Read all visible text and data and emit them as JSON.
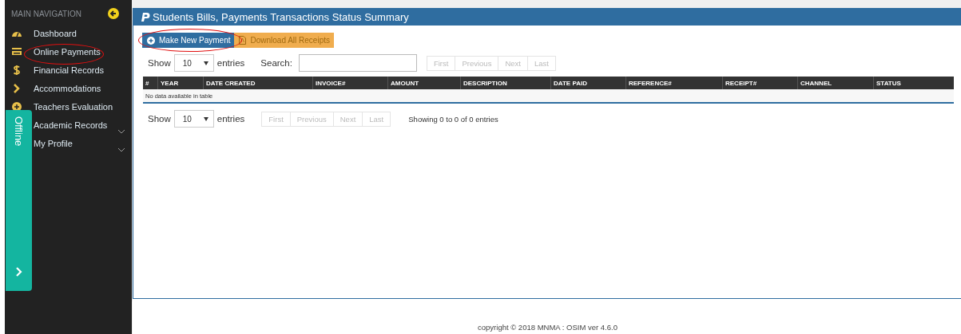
{
  "sidebar": {
    "header": "MAIN NAVIGATION",
    "items": [
      {
        "label": "Dashboard",
        "kind": "link"
      },
      {
        "label": "Online Payments",
        "kind": "link"
      },
      {
        "label": "Financial Records",
        "kind": "link"
      },
      {
        "label": "Accommodations",
        "kind": "link"
      },
      {
        "label": "Teachers Evaluation",
        "kind": "link"
      },
      {
        "label": "Academic Records",
        "kind": "group"
      },
      {
        "label": "My Profile",
        "kind": "group"
      }
    ],
    "status_tab": {
      "label": "Offline"
    }
  },
  "panel": {
    "title": "Students Bills, Payments Transactions Status Summary",
    "buttons": [
      {
        "label": "Make New Payment",
        "kind": "primary"
      },
      {
        "label": "Download All Receipts",
        "kind": "warning"
      }
    ],
    "length_top": {
      "before": "Show",
      "value": "10",
      "after": "entries"
    },
    "search": {
      "label": "Search:"
    },
    "pager_top": [
      "First",
      "Previous",
      "Next",
      "Last"
    ],
    "table": {
      "columns": [
        "#",
        "YEAR",
        "DATE CREATED",
        "INVOICE#",
        "AMOUNT",
        "DESCRIPTION",
        "DATE PAID",
        "REFERENCE#",
        "RECEIPT#",
        "CHANNEL",
        "STATUS"
      ],
      "empty": "No data available in table"
    },
    "length_bottom": {
      "before": "Show",
      "value": "10",
      "after": "entries"
    },
    "pager_bottom": [
      "First",
      "Previous",
      "Next",
      "Last"
    ],
    "info": "Showing 0 to 0 of 0 entries"
  },
  "footer": "copyright © 2018 MNMA : OSIM ver 4.6.0"
}
